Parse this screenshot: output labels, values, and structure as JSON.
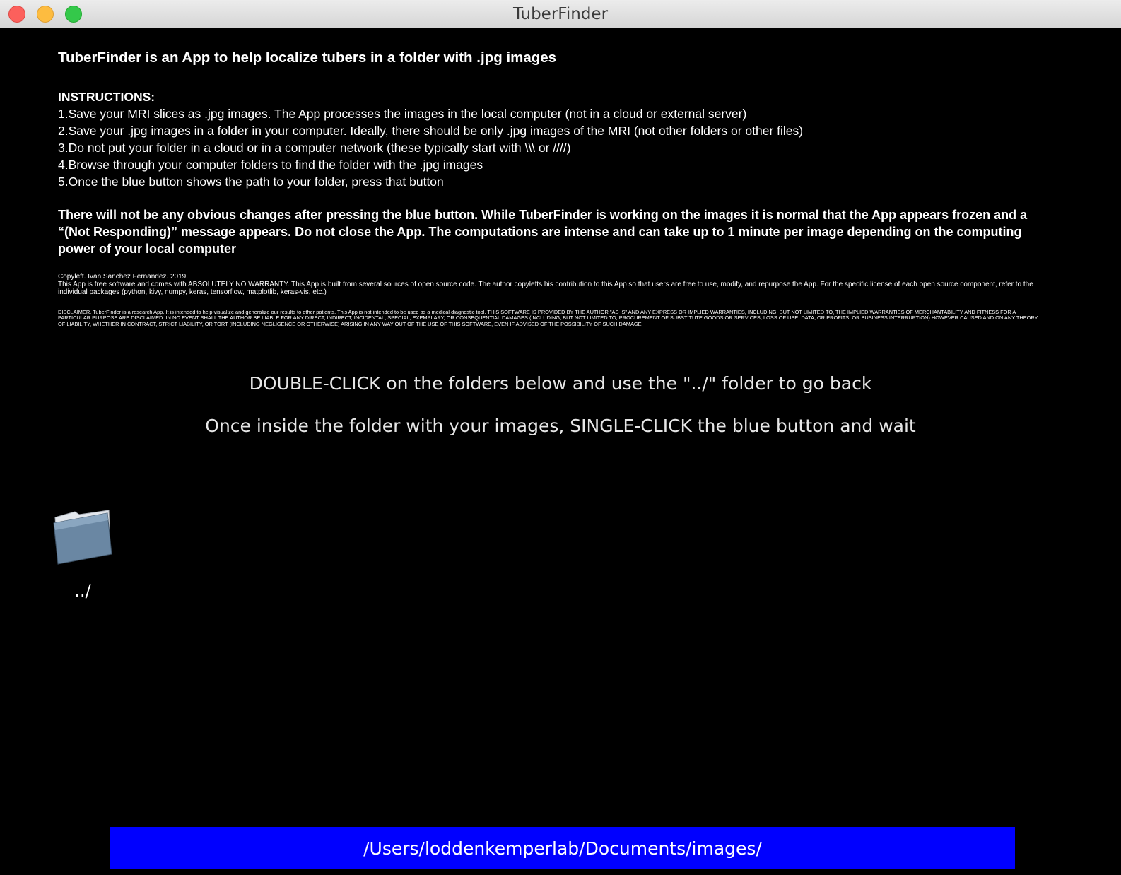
{
  "window": {
    "title": "TuberFinder",
    "controls": [
      "close",
      "minimize",
      "zoom"
    ]
  },
  "info": {
    "headline": "TuberFinder is an App to help localize tubers in a folder with .jpg images",
    "instructions_heading": "INSTRUCTIONS:",
    "steps": [
      "1.Save your MRI slices as .jpg images. The App processes the images in the local computer (not in a cloud or external server)",
      "2.Save your .jpg images in a folder in your computer. Ideally, there should be only .jpg images of the MRI (not other folders or other files)",
      "3.Do not put your folder in a cloud or in a computer network (these typically start with \\\\\\ or ////)",
      "4.Browse through your computer folders to find the folder with the .jpg images",
      "5.Once the blue button shows the path to your folder, press that button"
    ],
    "warning": "There will not be any obvious changes after pressing the blue button. While TuberFinder is working on the images it is normal that the App appears frozen and a “(Not Responding)” message appears. Do not close the App. The computations are intense and can take up to 1 minute per image depending on the computing power of your local computer",
    "copyleft": "Copyleft. Ivan Sanchez Fernandez. 2019.",
    "warranty": "This App is free software and comes with ABSOLUTELY NO WARRANTY. This App is built from several sources of open source code. The author copylefts his contribution to this App so that users are free to use, modify, and repurpose the App. For the specific license of each open source component, refer to the individual packages (python, kivy, numpy, keras, tensorflow, matplotlib, keras-vis, etc.)",
    "disclaimer": "DISCLAIMER. TuberFinder is a research App. It is intended to help visualize and generalize our results to other patients. This App is not intended to be used as a medical diagnostic tool. THIS SOFTWARE IS PROVIDED BY THE AUTHOR \"AS IS\" AND ANY EXPRESS OR IMPLIED WARRANTIES, INCLUDING, BUT NOT LIMITED TO, THE IMPLIED WARRANTIES OF MERCHANTABILITY AND FITNESS FOR A PARTICULAR PURPOSE ARE DISCLAIMED. IN NO EVENT SHALL THE AUTHOR BE LIABLE FOR ANY DIRECT, INDIRECT, INCIDENTAL, SPECIAL, EXEMPLARY, OR CONSEQUENTIAL DAMAGES (INCLUDING, BUT NOT LIMITED TO, PROCUREMENT OF SUBSTITUTE GOODS OR SERVICES; LOSS OF USE, DATA, OR PROFITS; OR BUSINESS INTERRUPTION) HOWEVER CAUSED AND ON ANY THEORY OF LIABILITY, WHETHER IN CONTRACT, STRICT LIABILITY, OR TORT (INCLUDING NEGLIGENCE OR OTHERWISE) ARISING IN ANY WAY OUT OF THE USE OF THIS SOFTWARE, EVEN IF ADVISED OF THE POSSIBILITY OF SUCH DAMAGE."
  },
  "hints": {
    "double_click": "DOUBLE-CLICK on the folders below and use the \"../\" folder to go back",
    "single_click": "Once inside the folder with your images, SINGLE-CLICK the blue button and wait"
  },
  "browser": {
    "items": [
      {
        "label": "../",
        "icon": "folder-icon"
      }
    ]
  },
  "path_button": {
    "label": "/Users/loddenkemperlab/Documents/images/",
    "color": "#0000ff"
  },
  "colors": {
    "background": "#000000",
    "text": "#ffffff",
    "button": "#0000ff"
  }
}
